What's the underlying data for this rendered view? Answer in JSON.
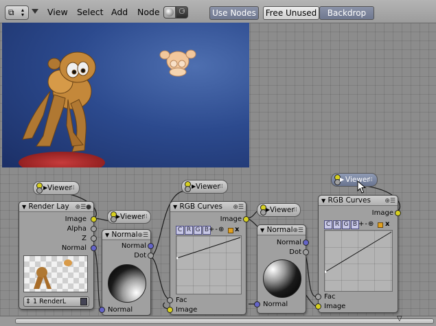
{
  "header": {
    "menus": [
      "View",
      "Select",
      "Add",
      "Node"
    ],
    "use_nodes": "Use Nodes",
    "free_unused": "Free Unused",
    "backdrop": "Backdrop"
  },
  "viewer_label": "Viewer",
  "render_layer": {
    "title": "Render Lay",
    "outputs": [
      "Image",
      "Alpha",
      "Z",
      "Normal"
    ],
    "layer_select": "1 RenderL"
  },
  "normal_nodes": {
    "title": "Normal",
    "out_normal": "Normal",
    "out_dot": "Dot",
    "in_normal": "Normal"
  },
  "rgb_curves": {
    "title": "RGB Curves",
    "out_image": "Image",
    "channels": [
      "C",
      "R",
      "G",
      "B"
    ],
    "tools": "+-⊕",
    "close": "x",
    "in_fac": "Fac",
    "in_image": "Image"
  },
  "colors": {
    "input_socket": "#d7d020",
    "vector_socket": "#6464c8",
    "grid": "#8c8c8c"
  }
}
